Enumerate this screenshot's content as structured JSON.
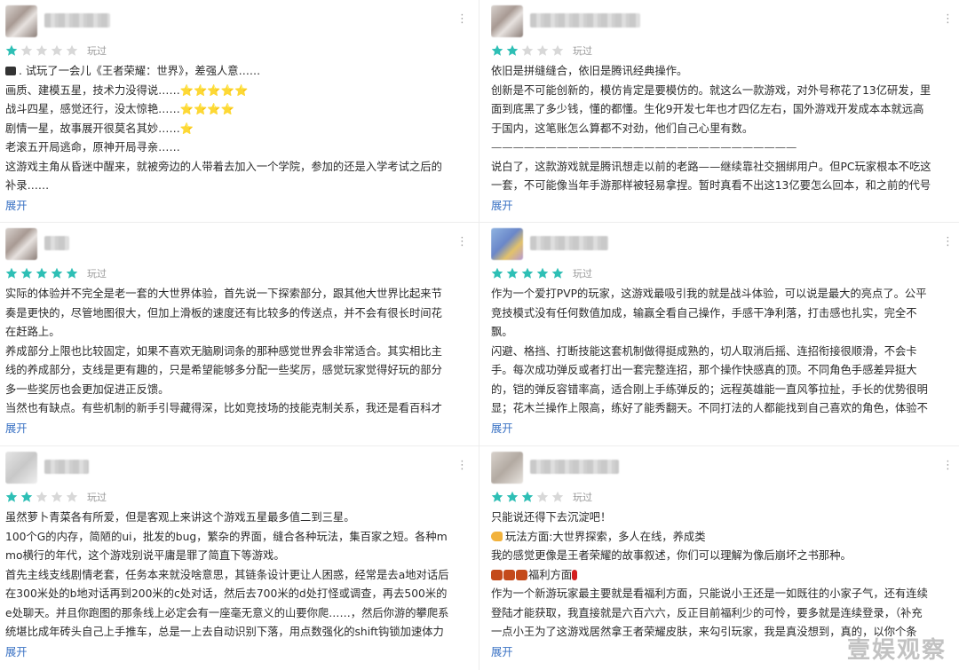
{
  "labels": {
    "played": "玩过",
    "expand": "展开"
  },
  "colors": {
    "star_filled": "#2ebfb5",
    "star_empty": "#d8d8d8",
    "link": "#3a72c4"
  },
  "reviews": [
    {
      "rating": 1,
      "lines": [
        ". 试玩了一会儿《王者荣耀：世界》，差强人意……",
        "画质、建模五星，技术力没得说……⭐⭐⭐⭐⭐",
        "战斗四星，感觉还行，没太惊艳……⭐⭐⭐⭐",
        "剧情一星，故事展开很莫名其妙……⭐",
        "老滚五开局逃命，原神开局寻亲……",
        "这游戏主角从昏迷中醒来，就被旁边的人带着去加入一个学院，参加的还是入学考试之后的",
        "补录……"
      ]
    },
    {
      "rating": 2,
      "lines": [
        "依旧是拼缝缝合，依旧是腾讯经典操作。",
        "创新是不可能创新的，模仿肯定是要模仿的。就这么一款游戏，对外号称花了13亿研发，里",
        "面到底黑了多少钱，懂的都懂。生化9开发七年也才四亿左右，国外游戏开发成本本就远高",
        "于国内，这笔账怎么算都不对劲，他们自己心里有数。",
        "————————————————————————————",
        "说白了，这款游戏就是腾讯想走以前的老路——继续靠社交捆绑用户。但PC玩家根本不吃这",
        "一套，不可能像当年手游那样被轻易拿捏。暂时真看不出这13亿要怎么回本，和之前的代号"
      ]
    },
    {
      "rating": 5,
      "lines": [
        "实际的体验并不完全是老一套的大世界体验，首先说一下探索部分，跟其他大世界比起来节",
        "奏是更快的，尽管地图很大，但加上滑板的速度还有比较多的传送点，并不会有很长时间花",
        "在赶路上。",
        "养成部分上限也比较固定，如果不喜欢无脑刷词条的那种感觉世界会非常适合。其实相比主",
        "线的养成部分，支线是更有趣的，只是希望能够多分配一些奖厉，感觉玩家觉得好玩的部分",
        "多一些奖厉也会更加促进正反馈。",
        "当然也有缺点。有些机制的新手引导藏得深，比如竞技场的技能克制关系，我还是看百科才"
      ]
    },
    {
      "rating": 5,
      "lines": [
        "作为一个爱打PVP的玩家，这游戏最吸引我的就是战斗体验，可以说是最大的亮点了。公平",
        "竞技模式没有任何数值加成，输赢全看自己操作，手感干净利落，打击感也扎实，完全不",
        "飘。",
        "闪避、格挡、打断技能这套机制做得挺成熟的，切人取消后摇、连招衔接很顺滑，不会卡",
        "手。每次成功弹反或者打出一套完整连招，那个操作快感真的顶。不同角色手感差异挺大",
        "的，铠的弹反容错率高，适合刚上手练弹反的；远程英雄能一直风筝拉扯，手长的优势很明",
        "显；花木兰操作上限高，练好了能秀翻天。不同打法的人都能找到自己喜欢的角色，体验不"
      ]
    },
    {
      "rating": 2,
      "lines": [
        "虽然萝卜青菜各有所爱，但是客观上来讲这个游戏五星最多值二到三星。",
        "100个G的内存，简陋的ui，批发的bug，繁杂的界面，缝合各种玩法，集百家之短。各种m",
        "mo横行的年代，这个游戏别说平庸是罪了简直下等游戏。",
        "首先主线支线剧情老套，任务本来就没啥意思，其链条设计更让人困惑，经常是去a地对话后",
        "在300米处的b地对话再到200米的c处对话，然后去700米的d处打怪或调查，再去500米的",
        "e处聊天。并且你跑图的那条线上必定会有一座毫无意义的山要你爬……，然后你游的攀爬系",
        "统堪比成年砖头自己上手推车，总是一上去自动识别下落，用点数强化的shift钩锁加速体力"
      ]
    },
    {
      "rating": 3,
      "lines": [
        "只能说还得下去沉淀吧！",
        "玩法方面:大世界探索，多人在线，养成类",
        "我的感觉更像是王者荣耀的故事叙述，你们可以理解为像后崩坏之书那种。",
        "福利方面",
        "作为一个新游玩家最主要就是看福利方面，只能说小王还是一如既往的小家子气，还有连续",
        "登陆才能获取，我直接就是六百六六，反正目前福利少的可怜，要多就是连续登录，（补充",
        "一点小王为了这游戏居然拿王者荣耀皮肤，来勾引玩家，我是真没想到，真的，以你个条"
      ]
    }
  ],
  "watermark": "壹娱观察"
}
